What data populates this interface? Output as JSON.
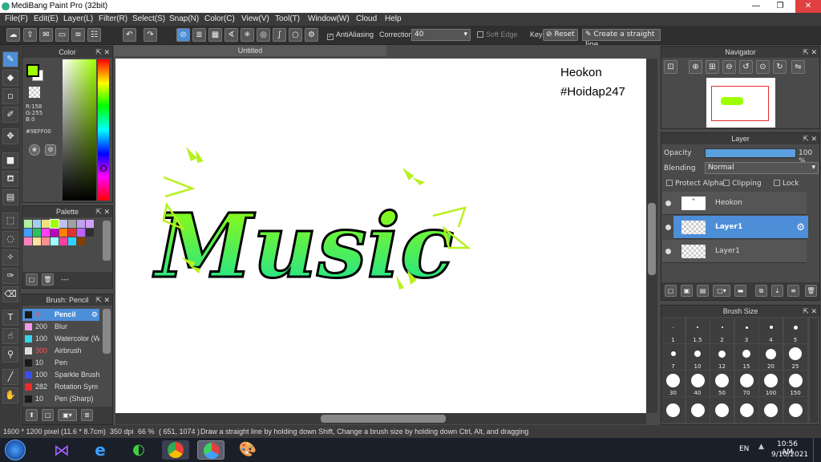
{
  "app": {
    "title": "MediBang Paint Pro (32bit)"
  },
  "window_controls": [
    "—",
    "❐",
    "✕"
  ],
  "menu": [
    "File(F)",
    "Edit(E)",
    "Layer(L)",
    "Filter(R)",
    "Select(S)",
    "Snap(N)",
    "Color(C)",
    "View(V)",
    "Tool(T)",
    "Window(W)",
    "Cloud",
    "Help"
  ],
  "toolbar": {
    "antialiasing": "AntiAliasing",
    "correction_label": "Correction",
    "correction_value": "40",
    "soft_edge": "Soft Edge",
    "key": "Key",
    "reset": "Reset",
    "straight_line": "Create a straight line"
  },
  "color_panel": {
    "title": "Color",
    "r": "R:158",
    "g": "G:255",
    "b": "B:0",
    "hex": "#9EFF00",
    "fg": "#9eff00",
    "bg": "#ffffff"
  },
  "palette_panel": {
    "title": "Palette",
    "more": "---"
  },
  "brush_panel": {
    "title": "Brush: Pencil",
    "items": [
      {
        "size": "4",
        "name": "Pencil",
        "color": "#1a1a1a"
      },
      {
        "size": "200",
        "name": "Blur",
        "color": "#f29ae6"
      },
      {
        "size": "100",
        "name": "Watercolor (W",
        "color": "#38d4ee"
      },
      {
        "size": "300",
        "name": "Airbrush",
        "color": "#dddddd"
      },
      {
        "size": "10",
        "name": "Pen",
        "color": "#1a1a1a"
      },
      {
        "size": "100",
        "name": "Sparkle Brush",
        "color": "#3850f0"
      },
      {
        "size": "282",
        "name": "Rotation Sym",
        "color": "#ee2a2a"
      },
      {
        "size": "10",
        "name": "Pen (Sharp)",
        "color": "#1a1a1a"
      }
    ]
  },
  "document": {
    "tab": "Untitled",
    "watermark_line1": "Heokon",
    "watermark_line2": "#Hoidap247",
    "art_text": "Music"
  },
  "navigator": {
    "title": "Navigator"
  },
  "layer_panel": {
    "title": "Layer",
    "opacity_label": "Opacity",
    "opacity_value": "100 %",
    "blending_label": "Blending",
    "blending_value": "Normal",
    "protect_alpha": "Protect Alpha",
    "clipping": "Clipping",
    "lock": "Lock",
    "layers": [
      {
        "name": "Heokon"
      },
      {
        "name": "Layer1"
      },
      {
        "name": "Layer1"
      }
    ]
  },
  "brush_size": {
    "title": "Brush Size",
    "sizes": [
      "1",
      "1.5",
      "2",
      "3",
      "4",
      "5",
      "7",
      "10",
      "12",
      "15",
      "20",
      "25",
      "30",
      "40",
      "50",
      "70",
      "100",
      "150"
    ]
  },
  "status": {
    "size": "1600 * 1200 pixel",
    "dims": "(11.6 * 8.7cm)",
    "dpi": "350 dpi",
    "zoom": "66 %",
    "coords": "( 651, 1074 )",
    "hint": "Draw a straight line by holding down Shift, Change a brush size by holding down Ctrl, Alt, and dragging"
  },
  "taskbar": {
    "lang": "EN",
    "time": "10:56 AM",
    "date": "9/10/2021"
  }
}
